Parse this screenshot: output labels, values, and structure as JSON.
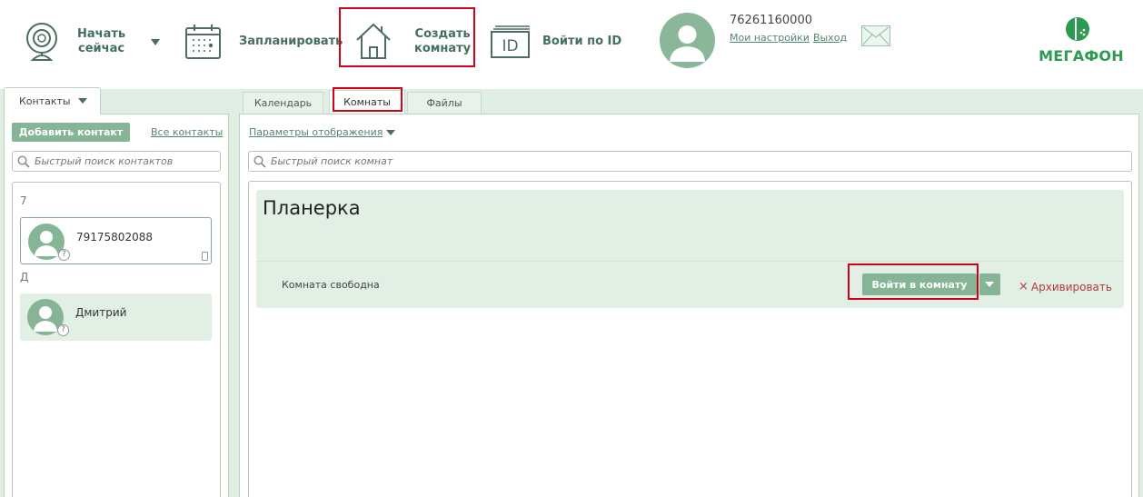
{
  "toolbar": {
    "start_now": {
      "line1": "Начать",
      "line2": "сейчас"
    },
    "schedule": "Запланировать",
    "create_room": {
      "line1": "Создать",
      "line2": "комнату"
    },
    "join_by_id": "Войти по ID",
    "id_icon_text": "ID"
  },
  "user": {
    "number": "76261160000",
    "settings_link": "Мои настройки",
    "logout_link": "Выход"
  },
  "logo": {
    "text": "МегаФон"
  },
  "left": {
    "tab_label": "Контакты",
    "add_contact": "Добавить контакт",
    "all_contacts": "Все контакты",
    "search_placeholder": "Быстрый поиск контактов",
    "groups": [
      {
        "letter": "7",
        "contacts": [
          {
            "name": "79175802088",
            "status": "?"
          }
        ]
      },
      {
        "letter": "Д",
        "contacts": [
          {
            "name": "Дмитрий",
            "status": "?"
          }
        ]
      }
    ]
  },
  "right": {
    "tabs": [
      {
        "label": "Календарь"
      },
      {
        "label": "Комнаты",
        "active": true
      },
      {
        "label": "Файлы"
      }
    ],
    "display_params": "Параметры отображения",
    "search_placeholder": "Быстрый поиск комнат",
    "rooms": [
      {
        "title": "Планерка",
        "status": "Комната свободна",
        "enter_label": "Войти в комнату",
        "archive_label": "Архивировать"
      }
    ]
  },
  "colors": {
    "accent_green": "#86b596",
    "text_green": "#44705b",
    "band": "#e0eee3",
    "highlight_red": "#d0021b",
    "archive_red": "#b33a3a"
  }
}
